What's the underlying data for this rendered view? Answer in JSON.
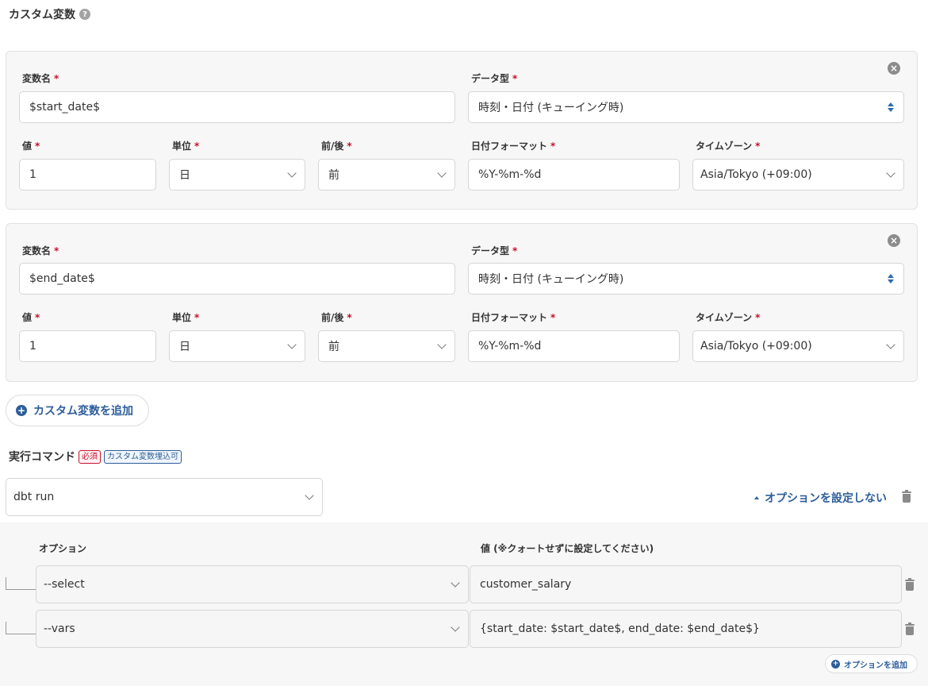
{
  "custom_vars": {
    "title": "カスタム変数",
    "help_icon": "?",
    "required_mark": "*",
    "labels": {
      "name": "変数名",
      "data_type": "データ型",
      "value": "値",
      "unit": "単位",
      "before_after": "前/後",
      "date_format": "日付フォーマット",
      "timezone": "タイムゾーン"
    },
    "items": [
      {
        "name": "$start_date$",
        "data_type": "時刻・日付 (キューイング時)",
        "value": "1",
        "unit": "日",
        "before_after": "前",
        "date_format": "%Y-%m-%d",
        "timezone": "Asia/Tokyo (+09:00)"
      },
      {
        "name": "$end_date$",
        "data_type": "時刻・日付 (キューイング時)",
        "value": "1",
        "unit": "日",
        "before_after": "前",
        "date_format": "%Y-%m-%d",
        "timezone": "Asia/Tokyo (+09:00)"
      }
    ],
    "add_label": "カスタム変数を追加"
  },
  "command": {
    "title": "実行コマンド",
    "badge_required": "必須",
    "badge_embed": "カスタム変数埋込可",
    "selected": "dbt run",
    "options_toggle": "オプションを設定しない"
  },
  "options": {
    "header_option": "オプション",
    "header_value": "値 (※クォートせずに設定してください)",
    "rows": [
      {
        "option": "--select",
        "value": "customer_salary"
      },
      {
        "option": "--vars",
        "value": "{start_date: $start_date$, end_date: $end_date$}"
      }
    ],
    "add_label": "オプションを追加"
  },
  "colors": {
    "accent": "#2c5d9b",
    "required": "#c8102e",
    "card_bg": "#f7f7f7"
  }
}
